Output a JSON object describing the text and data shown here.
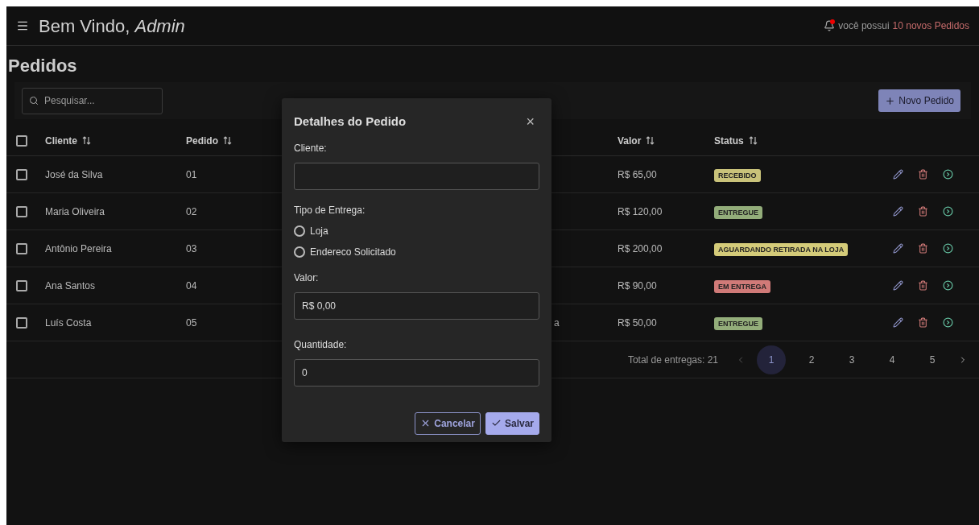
{
  "header": {
    "greeting": "Bem Vindo, *Admin*",
    "notice": "você possui",
    "notice_count": "10 novos Pedidos",
    "has_unread": true
  },
  "page_title": "Pedidos",
  "toolbar": {
    "search": {
      "placeholder": "Pesquisar..."
    },
    "new_button": "Novo Pedido"
  },
  "table": {
    "columns": [
      {
        "label": "Cliente",
        "sortable": true
      },
      {
        "label": "Pedido",
        "sortable": true
      },
      {
        "label": "Valor",
        "sortable": true
      },
      {
        "label": "Status",
        "sortable": true
      }
    ],
    "header_checked": false,
    "rows": [
      {
        "checked": false,
        "cliente": "José da Silva",
        "pedido": "01",
        "valor": "R$ 65,00",
        "status": "RECEBIDO",
        "color": "#c9c27a"
      },
      {
        "checked": false,
        "cliente": "Maria Oliveira",
        "pedido": "02",
        "valor": "R$ 120,00",
        "status": "ENTREGUE",
        "color": "#93ad7a"
      },
      {
        "checked": false,
        "cliente": "Antônio Pereira",
        "pedido": "03",
        "valor": "R$ 200,00",
        "status": "AGUARDANDO RETIRADA NA LOJA",
        "color": "#d4cb79"
      },
      {
        "checked": false,
        "cliente": "Ana Santos",
        "pedido": "04",
        "valor": "R$ 90,00",
        "status": "EM ENTREGA",
        "color": "#d07a78"
      },
      {
        "checked": false,
        "cliente": "Luís Costa",
        "pedido": "05",
        "column_3": "a",
        "valor": "R$ 50,00",
        "status": "ENTREGUE",
        "color": "#93ad7a"
      }
    ]
  },
  "pagination": {
    "total": "Total de entregas: 21",
    "prev_disabled": true,
    "pages": [
      {
        "label": "1",
        "selected": true
      },
      {
        "label": "2",
        "selected": false
      },
      {
        "label": "3",
        "selected": false
      },
      {
        "label": "4",
        "selected": false
      },
      {
        "label": "5",
        "selected": false
      }
    ]
  },
  "modal": {
    "title": "Detalhes do Pedido",
    "close": "×",
    "fields": [
      {
        "kind": "text",
        "label": "Cliente:"
      },
      {
        "kind": "radio",
        "label": "Tipo de Entrega:",
        "options": [
          {
            "label": "Loja",
            "selected": false
          },
          {
            "label": "Endereco Solicitado",
            "selected": false
          }
        ]
      },
      {
        "kind": "text",
        "label": "Valor:",
        "value": "R$ 0,00"
      },
      {
        "kind": "text",
        "label": "Quantidade:",
        "value": "0"
      }
    ],
    "buttons": [
      {
        "kind": "outline",
        "label": "Cancelar"
      },
      {
        "kind": "primary",
        "label": "Salvar"
      }
    ]
  }
}
